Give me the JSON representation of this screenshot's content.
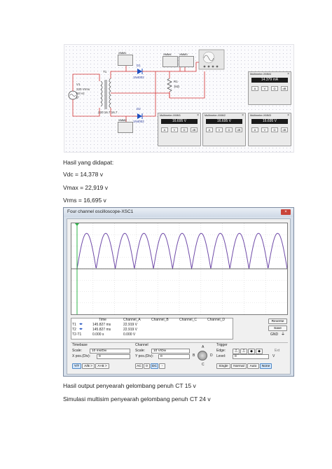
{
  "circuit": {
    "source_labels": [
      "V1",
      "220 Vrms",
      "60 Hz",
      "0°"
    ],
    "transformer_label": "T1",
    "transformer_ratio": "220:16.7:16.7",
    "diode1": {
      "name": "D1",
      "part": "1N4002"
    },
    "diode2": {
      "name": "D2",
      "part": "1N4002"
    },
    "resistor": {
      "name": "R1",
      "value": "1kΩ"
    },
    "probes": [
      "XMM1",
      "XMM2",
      "XMM4",
      "XMM3"
    ],
    "multimeters": [
      {
        "title": "Multimeter-XMM4",
        "reading": "14.379 mA"
      },
      {
        "title": "Multimeter-XMM1",
        "reading": "16.695 V"
      },
      {
        "title": "Multimeter-XMM2",
        "reading": "16.695 V"
      },
      {
        "title": "Multimeter-XMM3",
        "reading": "16.695 V"
      }
    ],
    "meter_buttons": [
      "A",
      "V",
      "Ω",
      "dB"
    ],
    "colors": {
      "wire": "#d32f2f",
      "diode": "#1f4fbf",
      "text_blue": "#2a3b9a"
    }
  },
  "text": {
    "results_heading": "Hasil yang didapat:",
    "vdc": "Vdc = 14,378 v",
    "vmax": "Vmax = 22,919 v",
    "vrms": "Vrms = 16,695 v",
    "caption1": "Hasil output penyearah gelombang penuh CT 15 v",
    "caption2": "Simulasi multisim penyearah gelombang penuh CT 24 v"
  },
  "oscilloscope": {
    "title": "Four channel oscilloscope-XSC1",
    "trace_color": "#6f4aa8",
    "cursor_color": "#2fb34a",
    "waveform": {
      "type": "full-wave rectified sine",
      "peaks_visible": 11,
      "peak_fraction": 0.78
    },
    "readout_headers": [
      "Time",
      "Channel_A",
      "Channel_B",
      "Channel_C",
      "Channel_D"
    ],
    "readout_rows": [
      {
        "label": "T1",
        "time": "145.827 ms",
        "a": "22.919 V"
      },
      {
        "label": "T2",
        "time": "145.827 ms",
        "a": "22.919 V"
      },
      {
        "label": "T2-T1",
        "time": "0.000 s",
        "a": "0.000 V"
      }
    ],
    "reverse_label": "Reverse",
    "save_label": "Save",
    "gnd_label": "GND",
    "timebase": {
      "heading": "Timebase",
      "scale_label": "Scale:",
      "scale_value": "10 ms/Div",
      "xpos_label": "X pos.(Div):",
      "xpos_value": "0"
    },
    "channel": {
      "heading": "Channel",
      "scale_label": "Scale:",
      "scale_value": "10 V/Div",
      "ypos_label": "Y pos.(Div):",
      "ypos_value": "0"
    },
    "knob_letters": [
      "A",
      "B",
      "C",
      "D"
    ],
    "trigger": {
      "heading": "Trigger",
      "edge_label": "Edge:",
      "ext_label": "Ext",
      "level_label": "Level:",
      "level_value": "0",
      "level_unit": "V"
    },
    "mode_buttons_left": [
      "Y/T",
      "A/B >",
      "A+B >"
    ],
    "channel_buttons": [
      "AC",
      "0",
      "DC",
      "-"
    ],
    "trigger_buttons": [
      "Single",
      "Normal",
      "Auto",
      "None"
    ],
    "active_trigger": "None"
  }
}
